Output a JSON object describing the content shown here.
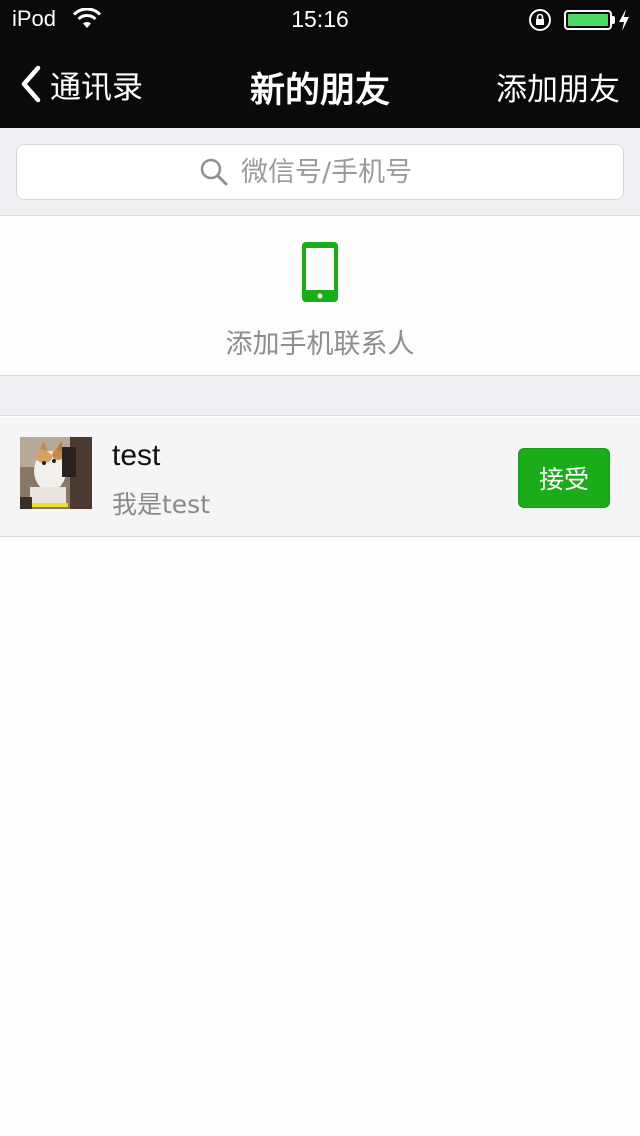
{
  "status_bar": {
    "carrier": "iPod",
    "time": "15:16",
    "battery_level": 1.0
  },
  "nav": {
    "back_label": "通讯录",
    "title": "新的朋友",
    "right_label": "添加朋友"
  },
  "search": {
    "placeholder": "微信号/手机号"
  },
  "add_contacts": {
    "label": "添加手机联系人"
  },
  "requests": [
    {
      "name": "test",
      "message": "我是test",
      "action_label": "接受"
    }
  ],
  "colors": {
    "accent_green": "#1aad19",
    "nav_background": "#0a0a0a",
    "page_background": "#efeff4"
  }
}
